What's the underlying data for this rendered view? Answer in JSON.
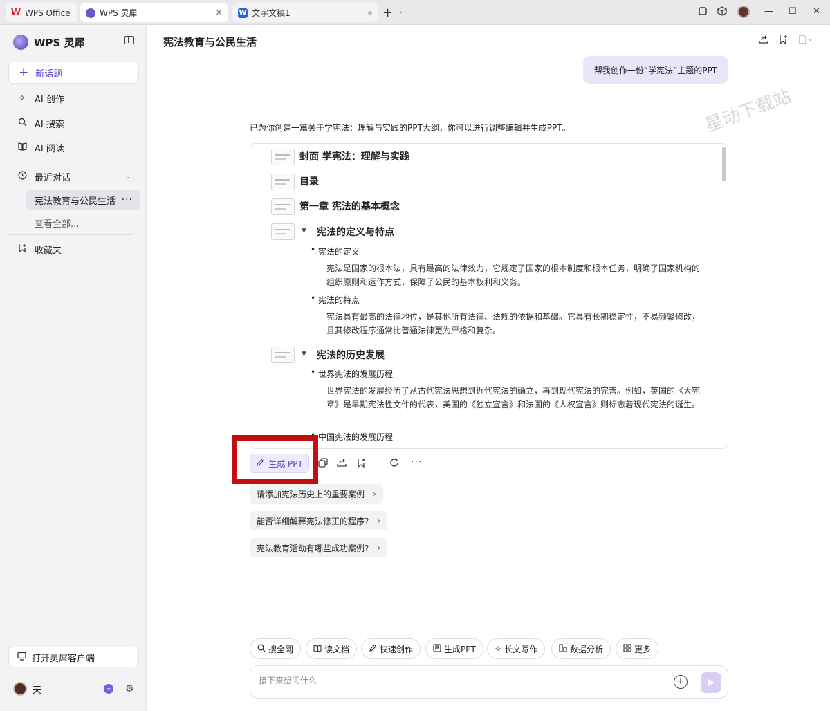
{
  "tabs": {
    "wps": {
      "label": "WPS Office"
    },
    "lingxi": {
      "label": "WPS 灵犀",
      "close": "×"
    },
    "doc": {
      "label": "文字文稿1",
      "icon_letter": "W"
    },
    "add": "+",
    "dropdown": "⌄"
  },
  "window_controls": {
    "minimize": "—",
    "maximize": "☐",
    "close": "✕"
  },
  "sidebar": {
    "brand": "WPS 灵犀",
    "new_topic": "新话题",
    "nav": [
      {
        "label": "AI 创作",
        "icon": "sparkle-icon"
      },
      {
        "label": "AI 搜索",
        "icon": "search-icon"
      },
      {
        "label": "AI 阅读",
        "icon": "book-icon"
      }
    ],
    "recent_label": "最近对话",
    "recent_active": "宪法教育与公民生活",
    "recent_more": "···",
    "view_all": "查看全部...",
    "favorites": "收藏夹",
    "open_client": "打开灵犀客户端",
    "user_name": "天"
  },
  "main": {
    "title": "宪法教育与公民生活",
    "user_message": "帮我创作一份“学宪法”主题的PPT",
    "watermark": "星动下载站",
    "intro": "已为你创建一篇关于学宪法：理解与实践的PPT大纲，你可以进行调整编辑并生成PPT。",
    "outline": {
      "cover": "封面 学宪法：理解与实践",
      "toc": "目录",
      "chapter1": "第一章 宪法的基本概念",
      "sec1": "宪法的定义与特点",
      "sec1_b1": "宪法的定义",
      "sec1_p1": "宪法是国家的根本法，具有最高的法律效力，它规定了国家的根本制度和根本任务，明确了国家机构的组织原则和运作方式，保障了公民的基本权利和义务。",
      "sec1_b2": "宪法的特点",
      "sec1_p2": "宪法具有最高的法律地位，是其他所有法律、法规的依据和基础。它具有长期稳定性，不易频繁修改，且其修改程序通常比普通法律更为严格和复杂。",
      "sec2": "宪法的历史发展",
      "sec2_b1": "世界宪法的发展历程",
      "sec2_p1": "世界宪法的发展经历了从古代宪法思想到近代宪法的确立，再到现代宪法的完善。例如，英国的《大宪章》是早期宪法性文件的代表，美国的《独立宣言》和法国的《人权宣言》则标志着现代宪法的诞生。",
      "sec2_b2": "中国宪法的发展历程",
      "toggle": "▼"
    },
    "generate_ppt": "生成 PPT",
    "more_actions": "···",
    "suggestions": [
      "请添加宪法历史上的重要案例",
      "能否详细解释宪法修正的程序?",
      "宪法教育活动有哪些成功案例?"
    ],
    "suggestion_chevron": "›",
    "tools": [
      {
        "label": "搜全网",
        "icon": "search-icon"
      },
      {
        "label": "读文档",
        "icon": "book-icon"
      },
      {
        "label": "快速创作",
        "icon": "pen-icon"
      },
      {
        "label": "生成PPT",
        "icon": "ppt-icon"
      },
      {
        "label": "长文写作",
        "icon": "sparkle-icon"
      },
      {
        "label": "数据分析",
        "icon": "chart-icon"
      },
      {
        "label": "更多",
        "icon": "grid-icon"
      }
    ],
    "input_placeholder": "接下来想问什么"
  },
  "colors": {
    "accent": "#5a43c6",
    "user_bubble": "#ebe5fa",
    "highlight_box": "#c20f0f"
  }
}
